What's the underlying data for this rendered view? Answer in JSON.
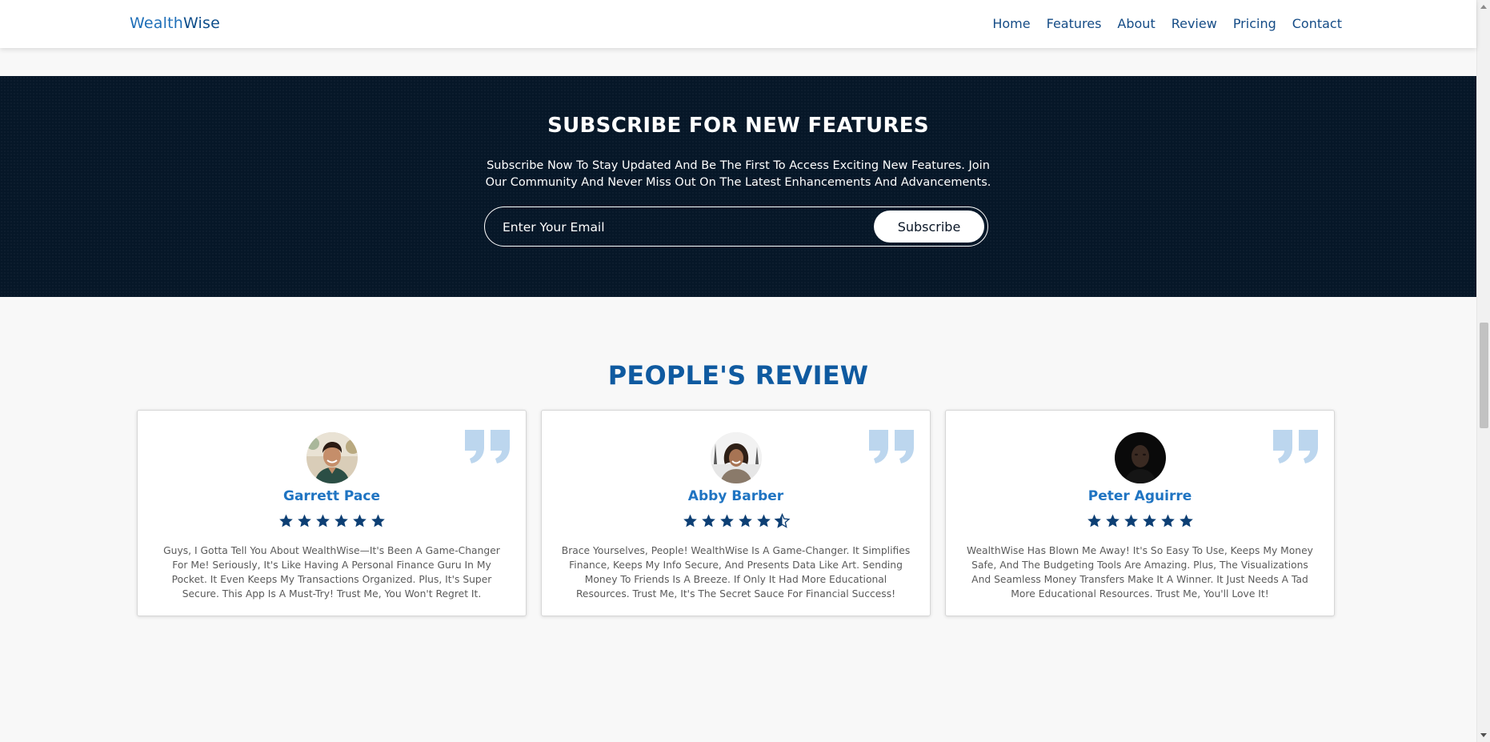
{
  "brand": {
    "part1": "Wealth",
    "part2": "Wise"
  },
  "nav": [
    "Home",
    "Features",
    "About",
    "Review",
    "Pricing",
    "Contact"
  ],
  "subscribe": {
    "title": "SUBSCRIBE FOR NEW FEATURES",
    "description": "Subscribe Now To Stay Updated And Be The First To Access Exciting New Features. Join Our Community And Never Miss Out On The Latest Enhancements And Advancements.",
    "placeholder": "Enter Your Email",
    "button_label": "Subscribe"
  },
  "reviews": {
    "title": "PEOPLE'S REVIEW",
    "items": [
      {
        "name": "Garrett Pace",
        "rating": 6,
        "text": "Guys, I Gotta Tell You About WealthWise—It's Been A Game-Changer For Me! Seriously, It's Like Having A Personal Finance Guru In My Pocket. It Even Keeps My Transactions Organized. Plus, It's Super Secure. This App Is A Must-Try! Trust Me, You Won't Regret It."
      },
      {
        "name": "Abby Barber",
        "rating": 5.5,
        "text": "Brace Yourselves, People! WealthWise Is A Game-Changer. It Simplifies Finance, Keeps My Info Secure, And Presents Data Like Art. Sending Money To Friends Is A Breeze. If Only It Had More Educational Resources. Trust Me, It's The Secret Sauce For Financial Success!"
      },
      {
        "name": "Peter Aguirre",
        "rating": 6,
        "text": "WealthWise Has Blown Me Away! It's So Easy To Use, Keeps My Money Safe, And The Budgeting Tools Are Amazing. Plus, The Visualizations And Seamless Money Transfers Make It A Winner. It Just Needs A Tad More Educational Resources. Trust Me, You'll Love It!"
      }
    ]
  },
  "colors": {
    "accent": "#1f74c2",
    "dark_band": "#061728",
    "star": "#0d3f74",
    "quote": "#bcd6ee"
  }
}
